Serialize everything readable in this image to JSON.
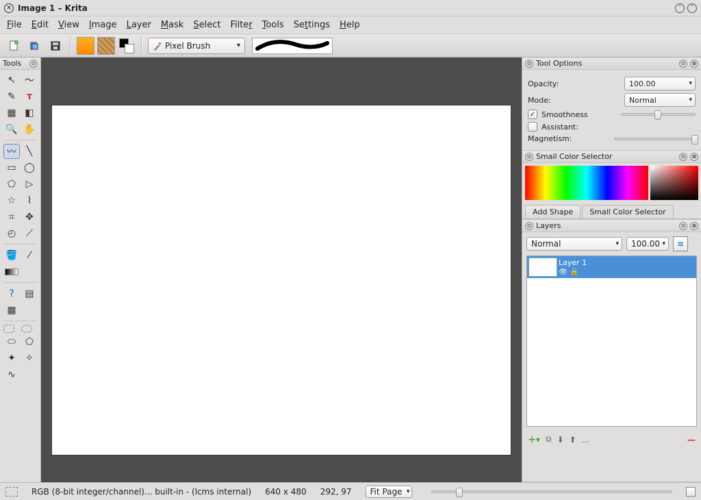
{
  "window": {
    "title": "Image 1 – Krita"
  },
  "menu": {
    "file": "File",
    "edit": "Edit",
    "view": "View",
    "image": "Image",
    "layer": "Layer",
    "mask": "Mask",
    "select": "Select",
    "filter": "Filter",
    "tools": "Tools",
    "settings": "Settings",
    "help": "Help"
  },
  "toolbar": {
    "brush_preset": "Pixel Brush"
  },
  "toolbox": {
    "title": "Tools"
  },
  "tool_options": {
    "title": "Tool Options",
    "opacity_label": "Opacity:",
    "opacity_value": "100.00",
    "mode_label": "Mode:",
    "mode_value": "Normal",
    "smoothness_label": "Smoothness",
    "assistant_label": "Assistant:",
    "magnetism_label": "Magnetism:"
  },
  "color_selector": {
    "title": "Small Color Selector"
  },
  "tabs": {
    "add_shape": "Add Shape",
    "small_color": "Small Color Selector"
  },
  "layers": {
    "title": "Layers",
    "blend_mode": "Normal",
    "opacity": "100.00",
    "items": [
      {
        "name": "Layer 1"
      }
    ],
    "more": "..."
  },
  "status": {
    "colorspace": "RGB (8-bit integer/channel)... built-in - (lcms internal)",
    "dimensions": "640 x 480",
    "cursor": "292, 97",
    "zoom": "Fit Page"
  }
}
